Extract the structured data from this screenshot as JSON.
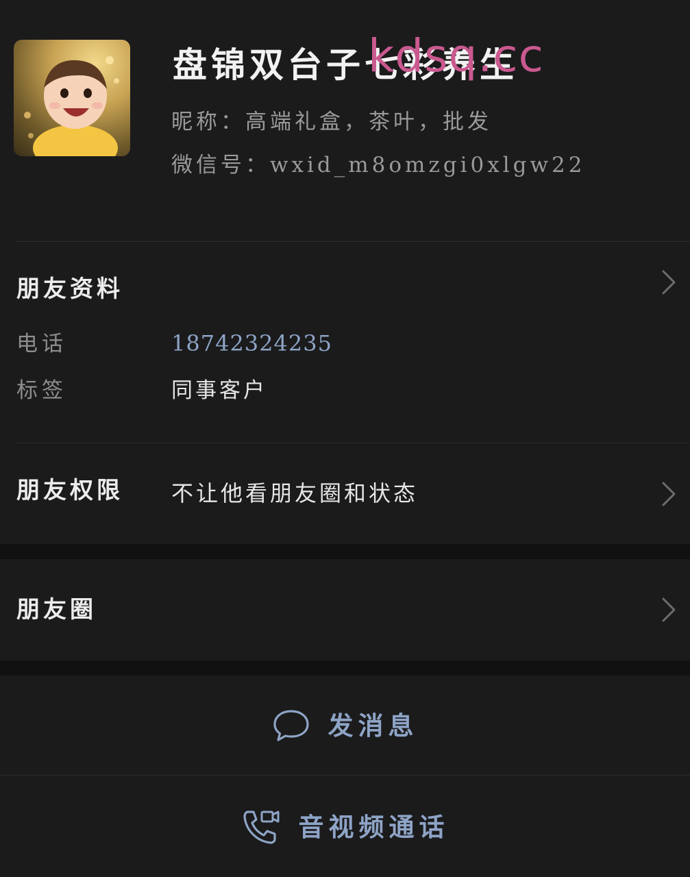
{
  "profile": {
    "display_name": "盘锦双台子七彩养生",
    "watermark": "kdsq.cc",
    "nickname_line": "昵称：高端礼盒，茶叶，批发",
    "wechat_id_line": "微信号：wxid_m8omzgi0xlgw22",
    "avatar": "baby-photo-avatar"
  },
  "friend_info": {
    "title": "朋友资料",
    "phone_label": "电话",
    "phone_value": "18742324235",
    "tag_label": "标签",
    "tag_value": "同事客户"
  },
  "permissions": {
    "title": "朋友权限",
    "value": "不让他看朋友圈和状态"
  },
  "moments": {
    "title": "朋友圈"
  },
  "actions": {
    "message_label": "发消息",
    "message_icon": "chat-bubble-icon",
    "call_label": "音视频通话",
    "call_icon": "phone-video-icon"
  },
  "colors": {
    "background": "#1b1b1c",
    "band": "#111111",
    "accent": "#8ea4c6",
    "watermark": "#c9598f"
  }
}
